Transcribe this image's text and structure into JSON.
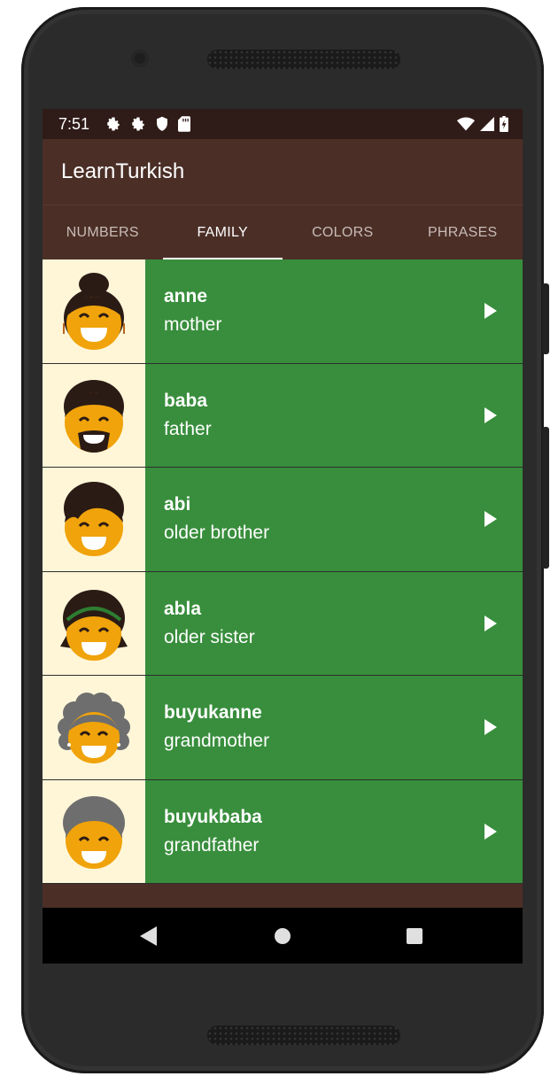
{
  "status": {
    "time": "7:51",
    "icons": [
      "gear-icon",
      "gear-icon",
      "shield-icon",
      "sd-card-icon"
    ],
    "right_icons": [
      "wifi-icon",
      "signal-icon",
      "battery-charging-icon"
    ]
  },
  "app": {
    "title": "LearnTurkish"
  },
  "tabs": [
    {
      "label": "NUMBERS",
      "active": false
    },
    {
      "label": "FAMILY",
      "active": true
    },
    {
      "label": "COLORS",
      "active": false
    },
    {
      "label": "PHRASES",
      "active": false
    }
  ],
  "words": [
    {
      "turkish": "anne",
      "english": "mother",
      "icon": "mother-face-icon"
    },
    {
      "turkish": "baba",
      "english": "father",
      "icon": "father-face-icon"
    },
    {
      "turkish": "abi",
      "english": "older brother",
      "icon": "older-brother-face-icon"
    },
    {
      "turkish": "abla",
      "english": "older sister",
      "icon": "older-sister-face-icon"
    },
    {
      "turkish": "buyukanne",
      "english": "grandmother",
      "icon": "grandmother-face-icon"
    },
    {
      "turkish": "buyukbaba",
      "english": "grandfather",
      "icon": "grandfather-face-icon"
    }
  ],
  "colors": {
    "primary_dark": "#2f1b17",
    "primary": "#4b2f27",
    "row_green": "#388e3c",
    "avatar_bg": "#fff6d8"
  },
  "nav": [
    "back-icon",
    "home-icon",
    "recents-icon"
  ]
}
